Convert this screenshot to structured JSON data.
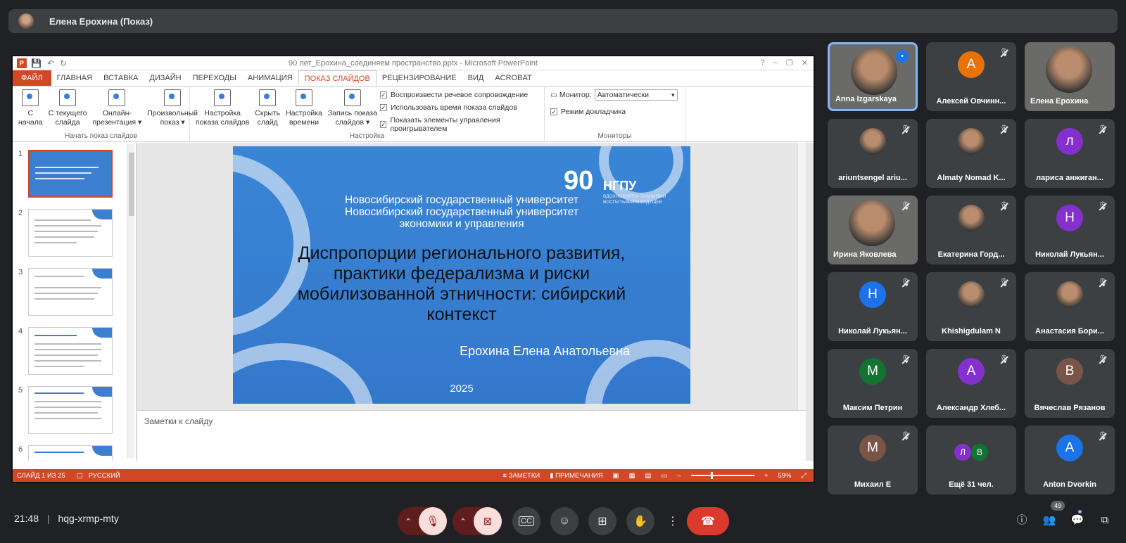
{
  "presenter": {
    "name": "Елена Ерохина (Показ)"
  },
  "powerpoint": {
    "window_title": "90 лет_Ерохина_соединяем пространство.pptx - Microsoft PowerPoint",
    "tabs": [
      "ФАЙЛ",
      "ГЛАВНАЯ",
      "ВСТАВКА",
      "ДИЗАЙН",
      "ПЕРЕХОДЫ",
      "АНИМАЦИЯ",
      "ПОКАЗ СЛАЙДОВ",
      "РЕЦЕНЗИРОВАНИЕ",
      "ВИД",
      "ACROBAT"
    ],
    "ribbon": {
      "from_start": "С\nначала",
      "from_current": "С текущего\nслайда",
      "online": "Онлайн-\nпрезентация ▾",
      "custom": "Произвольный\nпоказ ▾",
      "group1": "Начать показ слайдов",
      "setup": "Настройка\nпоказа слайдов",
      "hide": "Скрыть\nслайд",
      "timings": "Настройка\nвремени",
      "record": "Запись показа\nслайдов ▾",
      "chk_narration": "Воспроизвести речевое сопровождение",
      "chk_timings": "Использовать время показа слайдов",
      "chk_controls": "Показать элементы управления проигрывателем",
      "group2": "Настройка",
      "monitor_label": "Монитор:",
      "monitor_value": "Автоматически",
      "presenter_view": "Режим докладчика",
      "group3": "Мониторы"
    },
    "thumb_numbers": [
      "1",
      "2",
      "3",
      "4",
      "5",
      "6"
    ],
    "slide": {
      "logo_num": "90",
      "logo_name": "НГПУ",
      "logo_slogan": "ВДОХНОВЛЯЕМ ЗНАНИЯМИ ВОСПИТЫВАЕМ БУДУЩЕЕ",
      "uni_line1": "Новосибирский государственный университет",
      "uni_line2": "Новосибирский государственный университет",
      "uni_line3": "экономики и управления",
      "title": "Диспропорции регионального развития, практики федерализма и риски мобилизованной этничности: сибирский контекст",
      "author": "Ерохина Елена Анатольевна",
      "year": "2025"
    },
    "notes_placeholder": "Заметки к слайду",
    "status": {
      "slide_counter": "СЛАЙД 1 ИЗ 25",
      "language": "РУССКИЙ",
      "notes": "ЗАМЕТКИ",
      "comments": "ПРИМЕЧАНИЯ",
      "zoom": "59%"
    }
  },
  "participants": [
    {
      "name": "Anna Izgarskaya",
      "type": "video",
      "speaking": true
    },
    {
      "name": "Алексей Овчинн...",
      "initial": "А",
      "color": "#e8710a",
      "muted": true
    },
    {
      "name": "Елена Ерохина",
      "type": "video"
    },
    {
      "name": "ariuntsengel ariu...",
      "type": "photo",
      "muted": true
    },
    {
      "name": "Almaty Nomad K...",
      "type": "photo",
      "muted": true
    },
    {
      "name": "лариса анжиган...",
      "initial": "л",
      "color": "#8430ce",
      "muted": true
    },
    {
      "name": "Ирина Яковлева",
      "type": "video",
      "muted": true
    },
    {
      "name": "Екатерина Горд...",
      "type": "photo",
      "muted": true
    },
    {
      "name": "Николай Лукьян...",
      "initial": "Н",
      "color": "#8430ce",
      "muted": true
    },
    {
      "name": "Николай Лукьян...",
      "initial": "Н",
      "color": "#1a73e8",
      "muted": true
    },
    {
      "name": "Khishigdulam N",
      "type": "photo",
      "muted": true
    },
    {
      "name": "Анастасия Бори...",
      "type": "photo",
      "muted": true
    },
    {
      "name": "Максим Петрин",
      "initial": "М",
      "color": "#137333",
      "muted": true
    },
    {
      "name": "Александр Хлеб...",
      "initial": "А",
      "color": "#8430ce",
      "muted": true
    },
    {
      "name": "Вячеслав Рязанов",
      "initial": "В",
      "color": "#795548",
      "muted": true
    },
    {
      "name": "Михаил Е",
      "initial": "М",
      "color": "#795548",
      "muted": true
    },
    {
      "name": "Ещё 31 чел.",
      "type": "more",
      "initials": [
        "Л",
        "В"
      ]
    },
    {
      "name": "Anton Dvorkin",
      "initial": "A",
      "color": "#1a73e8",
      "muted": true
    }
  ],
  "meeting": {
    "time": "21:48",
    "separator": "|",
    "code": "hqg-xrmp-mty",
    "people_count": "49"
  }
}
